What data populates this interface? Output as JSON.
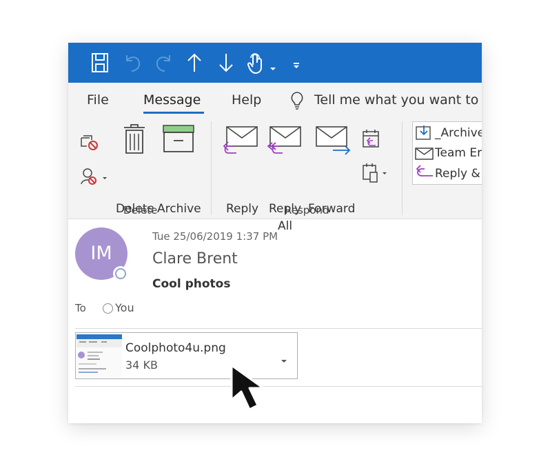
{
  "qat": {
    "icons": [
      "save-icon",
      "undo-icon",
      "redo-icon",
      "up-arrow-icon",
      "down-arrow-icon",
      "touch-mode-icon",
      "customize-caret-icon"
    ],
    "colors": {
      "bar": "#1a6ec5",
      "icon": "#ffffff",
      "disabled_icon": "#5b9ad8"
    }
  },
  "tabs": [
    {
      "label": "File"
    },
    {
      "label": "Message",
      "active": true
    },
    {
      "label": "Help"
    }
  ],
  "tell_me": {
    "label": "Tell me what you want to d"
  },
  "ribbon": {
    "delete_group": {
      "label": "Delete",
      "ignore_icon": "ignore-icon",
      "cleanup_icon": "cleanup-icon",
      "delete_label": "Delete",
      "archive_label": "Archive"
    },
    "respond_group": {
      "label": "Respond",
      "reply_label": "Reply",
      "reply_all_line1": "Reply",
      "reply_all_line2": "All",
      "forward_label": "Forward",
      "meeting_icon": "meeting-reply-icon",
      "more_icon": "more-respond-icon"
    },
    "quick_steps": [
      {
        "icon": "archive-move-icon",
        "label": "_Archive"
      },
      {
        "icon": "envelope-icon",
        "label": "Team Er"
      },
      {
        "icon": "reply-arrow-icon",
        "label": "Reply &"
      }
    ]
  },
  "message": {
    "avatar_initials": "IM",
    "avatar_color": "#a893d1",
    "date": "Tue 25/06/2019 1:37 PM",
    "sender": "Clare Brent",
    "subject": "Cool photos",
    "to_label": "To",
    "to_name": "You"
  },
  "attachment": {
    "name": "Coolphoto4u.png",
    "size": "34 KB"
  }
}
